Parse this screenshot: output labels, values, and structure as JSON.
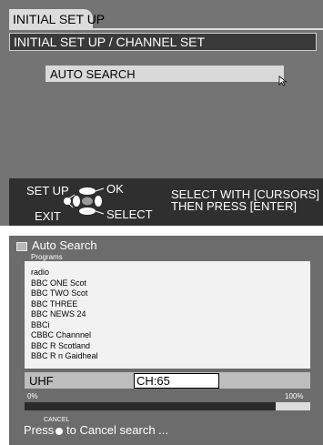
{
  "setup_screen": {
    "tab_title": "INITIAL SET UP",
    "subtitle": "INITIAL SET UP / CHANNEL SET",
    "menu_item": "AUTO SEARCH",
    "footer": {
      "setup_label": "SET UP",
      "exit_label": "EXIT",
      "ok_label": "OK",
      "select_label": "SELECT",
      "instruction_line1": "SELECT WITH [CURSORS]",
      "instruction_line2": "THEN PRESS [ENTER]"
    }
  },
  "auto_search": {
    "title": "Auto Search",
    "programs_label": "Programs",
    "programs": [
      "radio",
      "BBC ONE Scot",
      "BBC TWO Scot",
      "BBC THREE",
      "BBC NEWS 24",
      "BBCi",
      "CBBC Channnel",
      "BBC R Scotland",
      "BBC R n Gaidheal"
    ],
    "band": "UHF",
    "channel": "CH:65",
    "progress_min_label": "0%",
    "progress_max_label": "100%",
    "progress_fraction": 0.88,
    "cancel_small_label": "CANCEL",
    "cancel_prefix": "Press",
    "cancel_suffix": "to Cancel search ..."
  },
  "colors": {
    "panel_gray": "#747474",
    "footer_dark": "#2f2f2f",
    "highlight": "#d9d9d9",
    "progress_fill": "#2a2a2a"
  },
  "icons": {
    "cursor": "mouse-pointer-icon",
    "remote_dpad": "dpad-icon",
    "cancel_button": "round-button-icon",
    "title_marker": "window-icon"
  }
}
